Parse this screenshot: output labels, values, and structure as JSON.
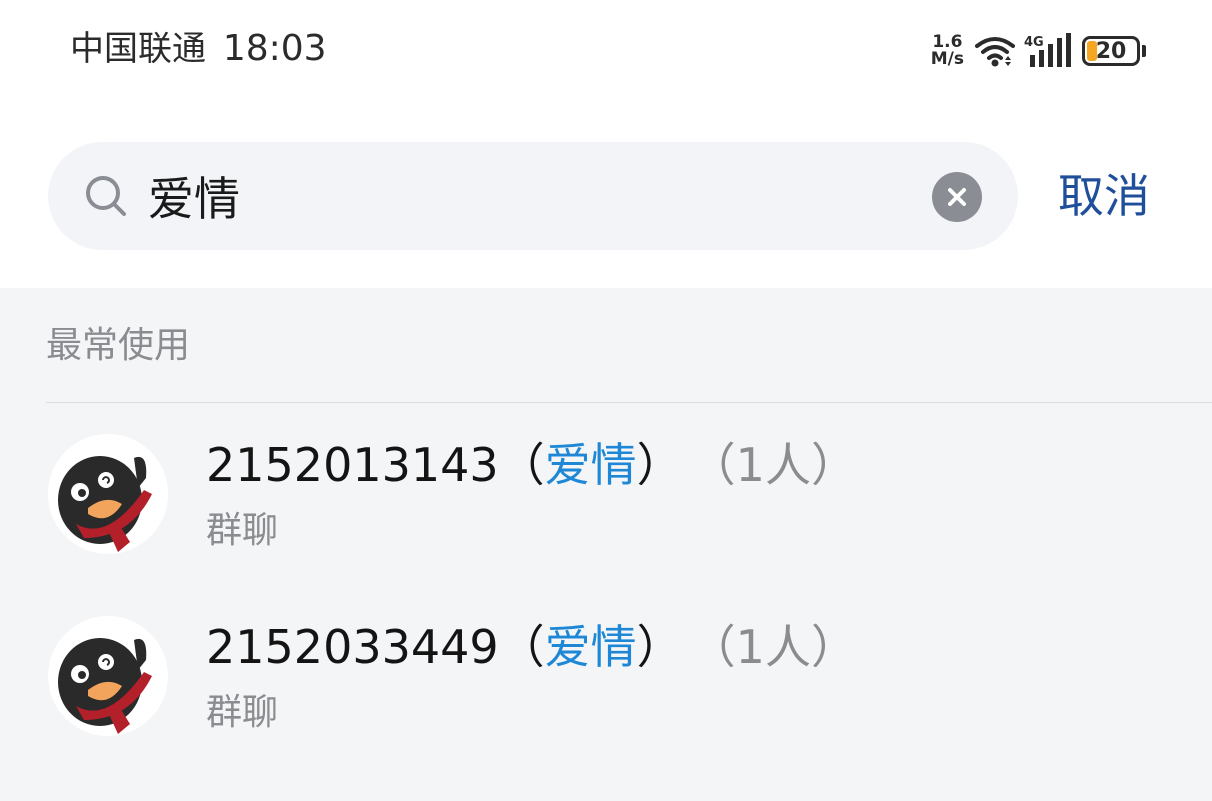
{
  "status_bar": {
    "carrier": "中国联通",
    "time": "18:03",
    "net_speed_value": "1.6",
    "net_speed_unit": "M/s",
    "signal_label": "4G",
    "battery_level": "20",
    "battery_color": "#f5a623",
    "icons": [
      "wifi-icon",
      "signal-icon",
      "battery-icon"
    ]
  },
  "search": {
    "query": "爱情",
    "cancel_label": "取消",
    "icons": [
      "search-icon",
      "clear-icon"
    ]
  },
  "results": {
    "section_title": "最常使用",
    "highlight_color": "#1e88d6",
    "items": [
      {
        "id_text": "2152013143",
        "open_paren": "（",
        "match": "爱情",
        "close_paren": "）",
        "count": "（1人）",
        "subtitle": "群聊",
        "avatar_icon": "penguin-avatar-icon"
      },
      {
        "id_text": "2152033449",
        "open_paren": "（",
        "match": "爱情",
        "close_paren": "）",
        "count": "（1人）",
        "subtitle": "群聊",
        "avatar_icon": "penguin-avatar-icon"
      }
    ]
  }
}
